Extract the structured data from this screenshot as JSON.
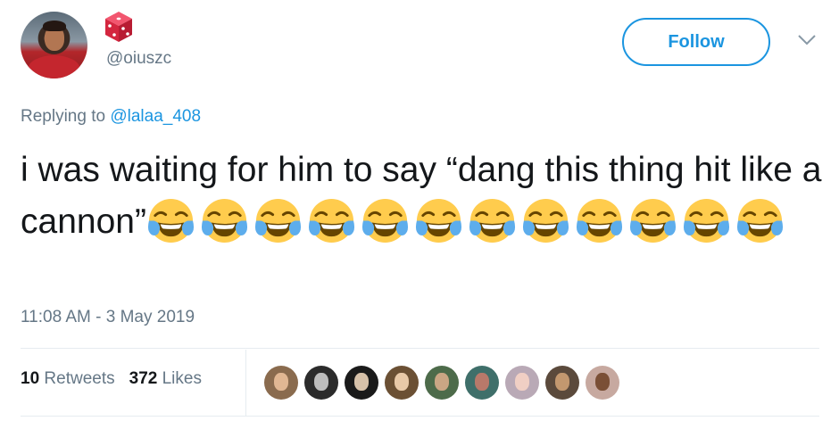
{
  "author": {
    "handle": "@oiuszc",
    "badge_icon": "die-icon"
  },
  "follow_button": {
    "label": "Follow"
  },
  "menu_icon": "chevron-down-icon",
  "reply": {
    "prefix": "Replying to ",
    "mention": "@lalaa_408"
  },
  "tweet": {
    "text": "i was waiting for him to say “dang this thing hit like a cannon”",
    "emoji_icon": "face-with-tears-of-joy-icon",
    "emoji_count": 12
  },
  "timestamp": "11:08 AM - 3 May 2019",
  "stats": {
    "retweets_count": "10",
    "retweets_label": "Retweets",
    "likes_count": "372",
    "likes_label": "Likes"
  },
  "liker_avatars": [
    {
      "bg": "#8a6b4e",
      "face": "#e1b793"
    },
    {
      "bg": "#2b2b2b",
      "face": "#bdbdbd"
    },
    {
      "bg": "#1a1a1a",
      "face": "#d6c1a9"
    },
    {
      "bg": "#6b5034",
      "face": "#e8c9a8"
    },
    {
      "bg": "#4d6b4a",
      "face": "#caa684"
    },
    {
      "bg": "#3f6f6a",
      "face": "#b8796a"
    },
    {
      "bg": "#b9a9b6",
      "face": "#f0cfc4"
    },
    {
      "bg": "#5b4a3c",
      "face": "#c3986f"
    },
    {
      "bg": "#c7a9a0",
      "face": "#7a4f36"
    }
  ],
  "colors": {
    "accent": "#1b95e0",
    "secondary_text": "#657786",
    "primary_text": "#14171a",
    "badge_red": "#e0245e"
  }
}
